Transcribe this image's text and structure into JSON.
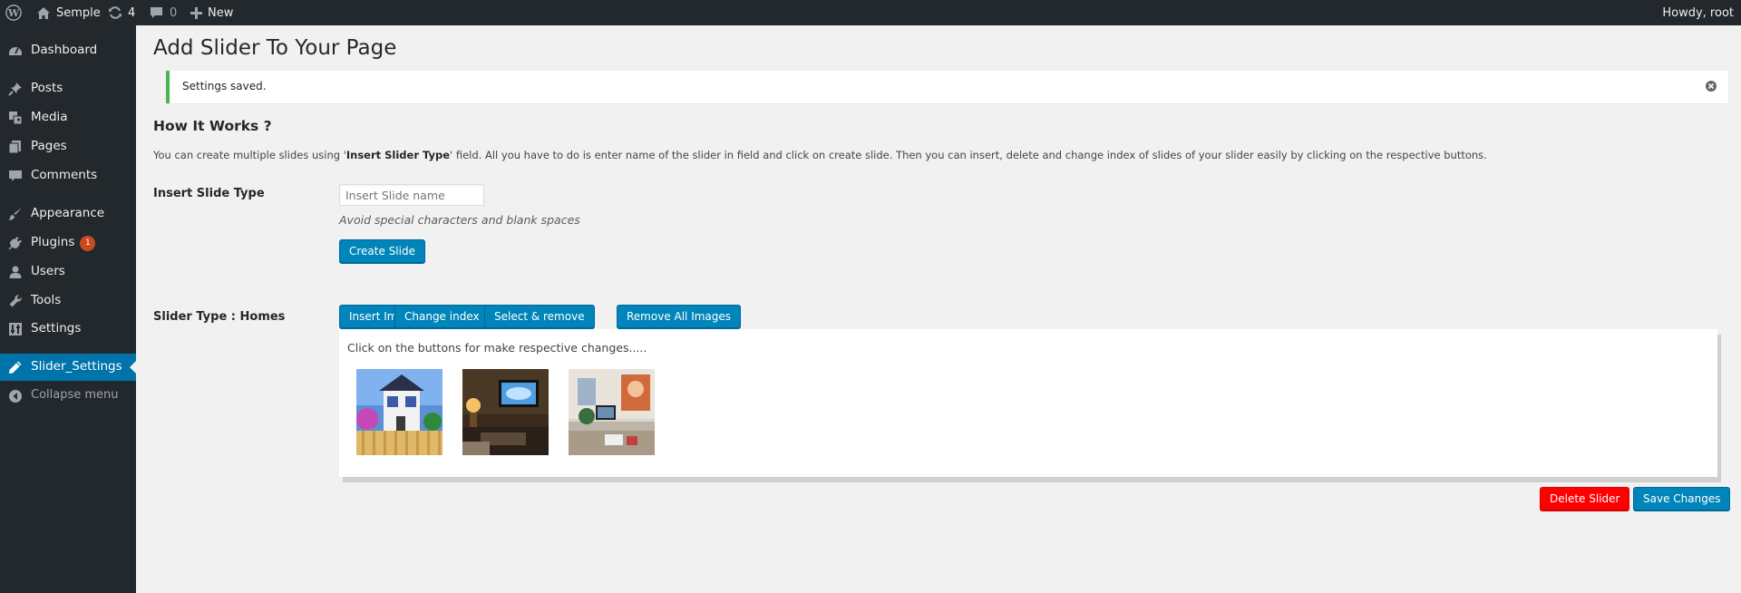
{
  "admin_bar": {
    "site_name": "Semple",
    "updates_count": "4",
    "comments_count": "0",
    "new_label": "New",
    "greeting": "Howdy, root"
  },
  "sidebar": {
    "items": [
      {
        "label": "Dashboard",
        "icon": "dashboard-icon"
      },
      {
        "label": "Posts",
        "icon": "pin-icon"
      },
      {
        "label": "Media",
        "icon": "media-icon"
      },
      {
        "label": "Pages",
        "icon": "pages-icon"
      },
      {
        "label": "Comments",
        "icon": "comment-icon"
      },
      {
        "label": "Appearance",
        "icon": "brush-icon"
      },
      {
        "label": "Plugins",
        "icon": "plug-icon",
        "badge": "1"
      },
      {
        "label": "Users",
        "icon": "user-icon"
      },
      {
        "label": "Tools",
        "icon": "wrench-icon"
      },
      {
        "label": "Settings",
        "icon": "settings-icon"
      },
      {
        "label": "Slider_Settings",
        "icon": "pencil-icon",
        "current": true
      },
      {
        "label": "Collapse menu",
        "icon": "collapse-icon"
      }
    ]
  },
  "main": {
    "page_title": "Add Slider To Your Page",
    "notice": "Settings saved.",
    "how_title": "How It Works ?",
    "how_text_1": "You can create multiple slides using '",
    "how_text_bold": "Insert Slider Type",
    "how_text_2": "' field. All you have to do is enter name of the slider in field and click on create slide. Then you can insert, delete and change index of slides of your slider easily by clicking on the respective buttons.",
    "insert_label": "Insert Slide Type",
    "insert_placeholder": "Insert Slide name",
    "hint": "Avoid special characters and blank spaces",
    "create_button": "Create Slide",
    "slider_type_label": "Slider Type : Homes",
    "buttons": {
      "insert_images": "Insert Images",
      "change_index": "Change index",
      "select_remove": "Select & remove",
      "remove_all": "Remove All Images"
    },
    "panel_hint": "Click on the buttons for make respective changes.....",
    "delete_button": "Delete Slider",
    "save_button": "Save Changes"
  },
  "colors": {
    "admin_dark": "#23282d",
    "primary": "#0085ba",
    "current_menu": "#0073aa",
    "danger": "#ff0000",
    "notice_success": "#46b450"
  }
}
